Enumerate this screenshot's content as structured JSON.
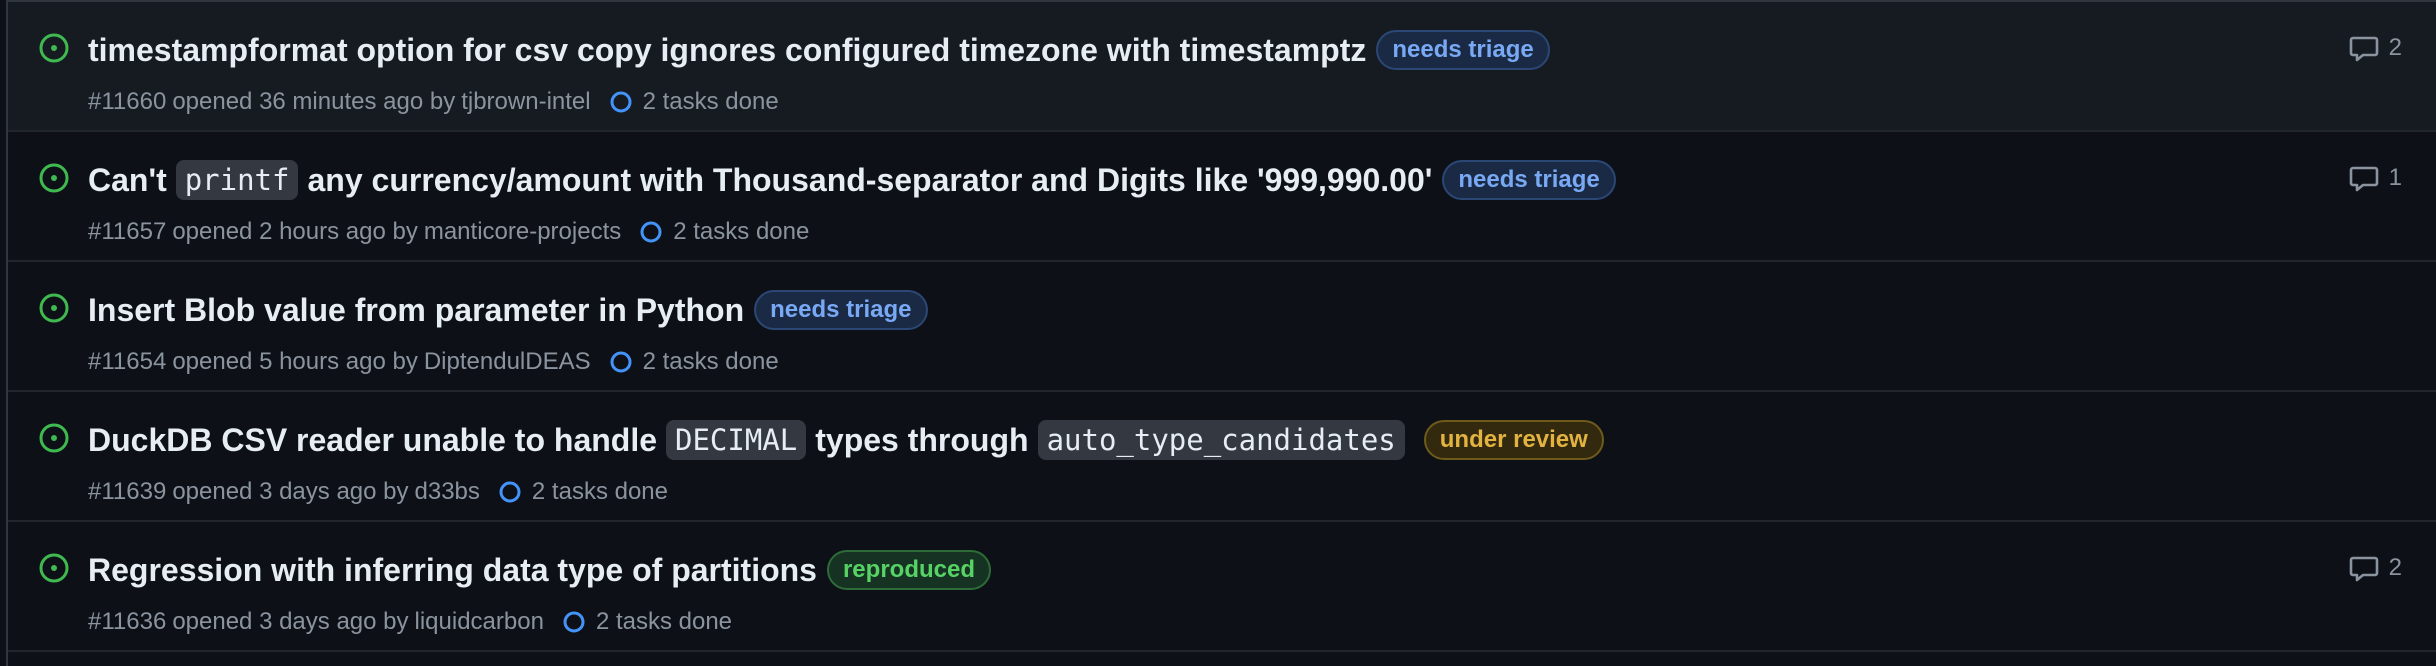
{
  "issues": [
    {
      "title_parts": [
        "timestampformat option for csv copy ignores configured timezone with timestamptz"
      ],
      "code_parts": [],
      "label": "needs triage",
      "label_kind": "triage",
      "number": "#11660",
      "opened_text": "opened 36 minutes ago by",
      "author": "tjbrown-intel",
      "tasks": "2 tasks done",
      "comments": "2"
    },
    {
      "title_parts": [
        "Can't",
        "any currency/amount with Thousand-separator and Digits like '999,990.00'"
      ],
      "code_parts": [
        "printf"
      ],
      "label": "needs triage",
      "label_kind": "triage",
      "number": "#11657",
      "opened_text": "opened 2 hours ago by",
      "author": "manticore-projects",
      "tasks": "2 tasks done",
      "comments": "1"
    },
    {
      "title_parts": [
        "Insert Blob value from parameter in Python"
      ],
      "code_parts": [],
      "label": "needs triage",
      "label_kind": "triage",
      "number": "#11654",
      "opened_text": "opened 5 hours ago by",
      "author": "DiptendulDEAS",
      "tasks": "2 tasks done",
      "comments": ""
    },
    {
      "title_parts": [
        "DuckDB CSV reader unable to handle",
        "types through",
        ""
      ],
      "code_parts": [
        "DECIMAL",
        "auto_type_candidates"
      ],
      "label": "under review",
      "label_kind": "review",
      "number": "#11639",
      "opened_text": "opened 3 days ago by",
      "author": "d33bs",
      "tasks": "2 tasks done",
      "comments": ""
    },
    {
      "title_parts": [
        "Regression with inferring data type of partitions"
      ],
      "code_parts": [],
      "label": "reproduced",
      "label_kind": "repro",
      "number": "#11636",
      "opened_text": "opened 3 days ago by",
      "author": "liquidcarbon",
      "tasks": "2 tasks done",
      "comments": "2"
    }
  ],
  "icons": {
    "status": "issue-opened-icon",
    "tasks": "task-progress-icon",
    "comments": "comment-icon"
  },
  "colors": {
    "open": "#3fb950",
    "tasks_ring": "#4493f8",
    "muted": "#8b949e"
  }
}
